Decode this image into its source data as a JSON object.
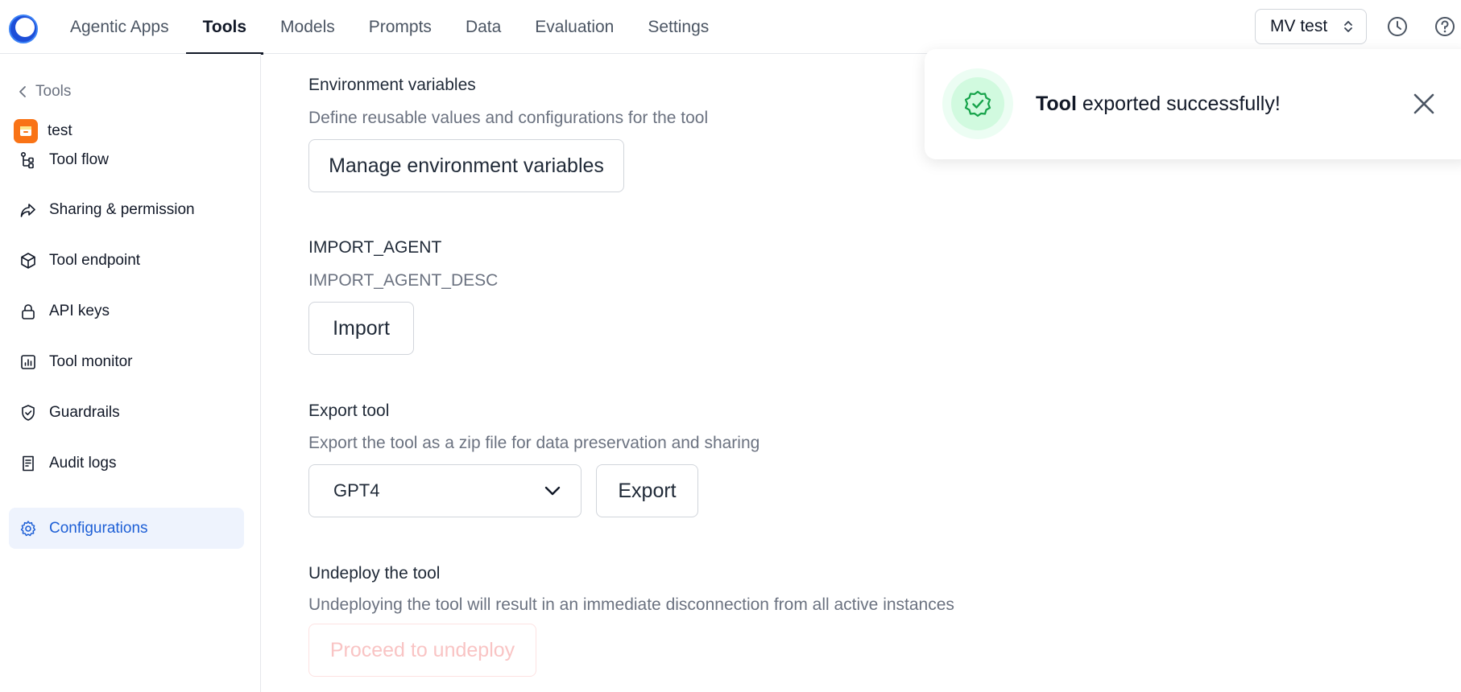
{
  "nav": {
    "tabs": [
      {
        "label": "Agentic Apps"
      },
      {
        "label": "Tools"
      },
      {
        "label": "Models"
      },
      {
        "label": "Prompts"
      },
      {
        "label": "Data"
      },
      {
        "label": "Evaluation"
      },
      {
        "label": "Settings"
      }
    ],
    "active_tab": "Tools",
    "workspace": "MV test",
    "icons": [
      "history-icon",
      "help-icon"
    ]
  },
  "sidebar": {
    "back_label": "Tools",
    "app_name": "test",
    "items": [
      {
        "label": "Tool flow",
        "icon": "flow-icon"
      },
      {
        "label": "Sharing & permission",
        "icon": "share-icon"
      },
      {
        "label": "Tool endpoint",
        "icon": "cube-icon"
      },
      {
        "label": "API keys",
        "icon": "lock-icon"
      },
      {
        "label": "Tool monitor",
        "icon": "chart-icon"
      },
      {
        "label": "Guardrails",
        "icon": "shield-icon"
      },
      {
        "label": "Audit logs",
        "icon": "log-icon"
      },
      {
        "label": "Configurations",
        "icon": "gear-icon"
      }
    ],
    "active_item": "Configurations"
  },
  "main": {
    "env": {
      "title": "Environment variables",
      "desc": "Define reusable values and configurations for the tool",
      "button": "Manage environment variables"
    },
    "import": {
      "title": "IMPORT_AGENT",
      "desc": "IMPORT_AGENT_DESC",
      "button": "Import"
    },
    "export": {
      "title": "Export tool",
      "desc": "Export the tool as a zip file for data preservation and sharing",
      "selected_model": "GPT4",
      "button": "Export"
    },
    "undeploy": {
      "title": "Undeploy the tool",
      "desc": "Undeploying the tool will result in an immediate disconnection from all active instances",
      "button": "Proceed to undeploy"
    }
  },
  "toast": {
    "bold": "Tool",
    "message": "exported successfully!"
  },
  "colors": {
    "accent": "#1d5fd6",
    "active_bg": "#eef3fd",
    "success": "#16a34a",
    "app_badge": "#f97316"
  }
}
